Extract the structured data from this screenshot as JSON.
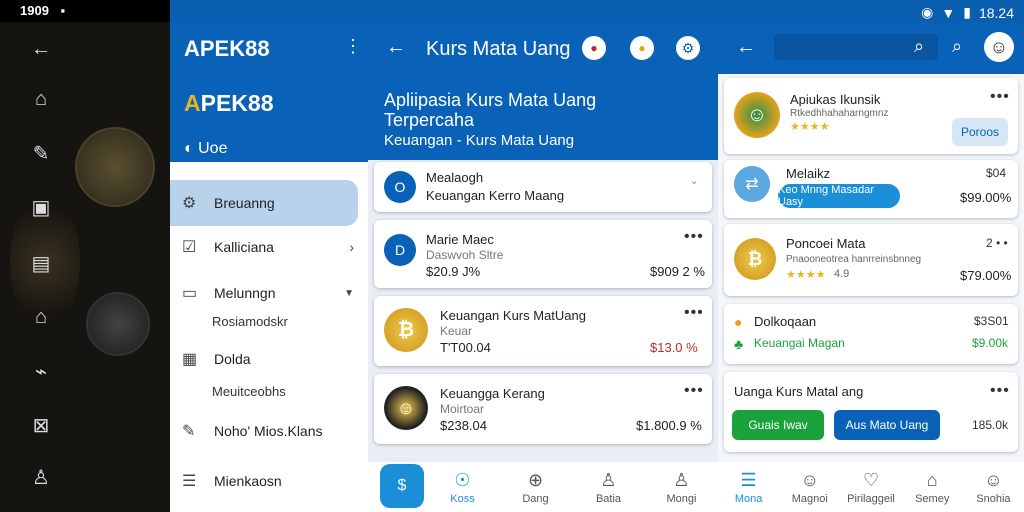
{
  "status": {
    "time_left": "1909",
    "time_right": "18.24"
  },
  "drawer": {
    "title": "APEK88",
    "brand_prefix": "A",
    "brand_rest": "PEK88",
    "sub": "Uoe",
    "items": [
      {
        "label": "Breuanng"
      },
      {
        "label": "Kalliciana"
      },
      {
        "label": "Melunngn",
        "sub": "Rosiamodskr"
      },
      {
        "label": "Dolda",
        "sub": "Meuitceobhs"
      },
      {
        "label": "Noho' Mios.Klans"
      },
      {
        "label": "Mienkaosn"
      }
    ]
  },
  "mid": {
    "title": "Kurs Mata Uang",
    "banner_line1": "Apliipasia Kurs Mata Uang",
    "banner_line2": "Terpercaha",
    "banner_sub": "Keuangan - Kurs Mata Uang",
    "cards": [
      {
        "title": "Mealaogh",
        "sub": "Keuangan Kerro Maang"
      },
      {
        "title": "Marie Maec",
        "sub": "Daswvoh Sltre",
        "left": "$20.9 J%",
        "right": "$909 2 %"
      },
      {
        "title": "Keuangan Kurs MatUang",
        "sub": "Keuar",
        "left": "T'T00.04",
        "right": "$13.0 %"
      },
      {
        "title": "Keuangga Kerang",
        "sub": "Moirtoar",
        "left": "$238.04",
        "right": "$1.800.9 %"
      }
    ],
    "nav": [
      {
        "label": "Koss",
        "icon": "☉"
      },
      {
        "label": "Dang",
        "icon": "⊕"
      },
      {
        "label": "Batia",
        "icon": "♙"
      },
      {
        "label": "Mongi",
        "icon": "♙"
      }
    ]
  },
  "right": {
    "cards": [
      {
        "title": "Apiukas Ikunsik",
        "sub": "Rtkedhhahaharngmnz",
        "stars": "★★★★",
        "button": "Poroos"
      },
      {
        "title": "Melaikz",
        "value_top": "$04",
        "value": "$99.00%",
        "button": "Keo Mnng Masadar Uasy"
      },
      {
        "title": "Poncoei Mata",
        "sub": "Pnaooneotrea hanrreinsbnneg",
        "stars": "★★★★",
        "rating": "4.9",
        "dots": "2 • •",
        "value": "$79.00%"
      },
      {
        "title": "Dolkoqaan",
        "sub": "Keuangai Magan",
        "value_top": "$3S01",
        "value": "$9.00k"
      },
      {
        "title": "Uanga Kurs Matal ang",
        "btn_green": "Guais Iwav",
        "btn_blue": "Aus Mato Uang",
        "value": "185.0k"
      }
    ],
    "nav": [
      {
        "label": "Mona",
        "icon": "☰"
      },
      {
        "label": "Magnoi",
        "icon": "☺"
      },
      {
        "label": "Pirilaggeil",
        "icon": "♡"
      },
      {
        "label": "Semey",
        "icon": "⌂"
      },
      {
        "label": "Snohia",
        "icon": "☺"
      }
    ]
  },
  "colors": {
    "primary": "#0a62b8",
    "green": "#1aa33c",
    "red": "#c62828",
    "gold": "#e6b61c"
  }
}
